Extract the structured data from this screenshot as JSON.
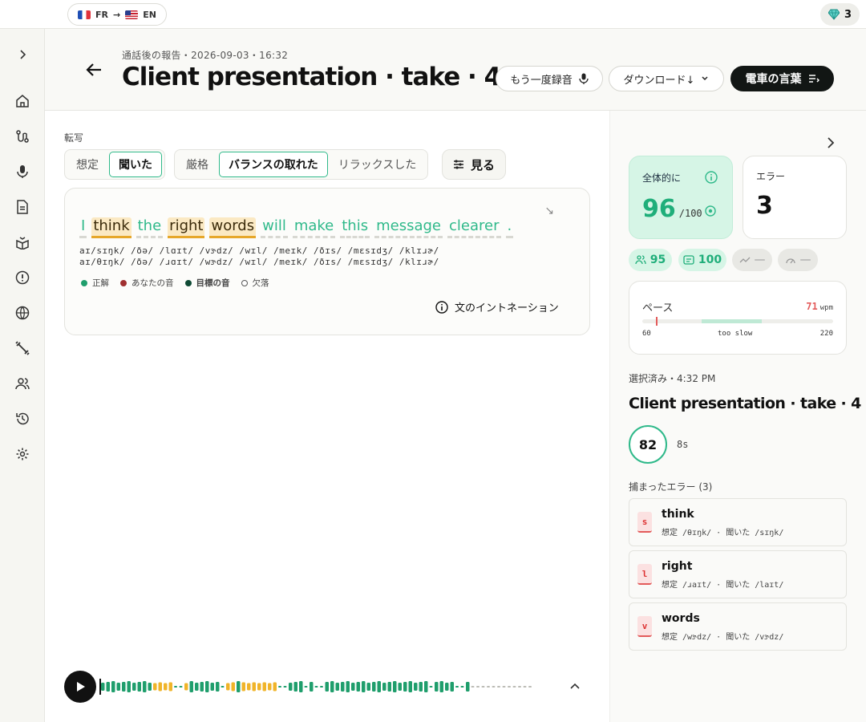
{
  "topbar": {
    "from": "FR",
    "to": "EN",
    "gems": "3"
  },
  "header": {
    "subtitle": "通話後の報告・2026-09-03・16:32",
    "title": "Client presentation · take · 4",
    "rerecord": "もう一度録音",
    "download": "ダウンロード↓",
    "phrases": "電車の言葉"
  },
  "transcript": {
    "label": "転写",
    "seg1": [
      "想定",
      "聞いた"
    ],
    "seg2": [
      "厳格",
      "バランスの取れた",
      "リラックスした"
    ],
    "view": "見る",
    "words": [
      "I",
      "think",
      "the",
      "right",
      "words",
      "will",
      "make",
      "this",
      "message",
      "clearer",
      "."
    ],
    "ipa_expected": "aɪ/sɪŋk/ /ðə/ /lɑɪt/ /vɝdz/ /wɪl/ /meɪk/ /ðɪs/ /mɛsɪdʒ/ /klɪɹɚ/",
    "ipa_heard": "aɪ/θɪŋk/ /ðə/ /ɹɑɪt/ /wɝdz/ /wɪl/ /meɪk/ /ðɪs/ /mɛsɪdʒ/ /klɪɹɚ/",
    "legend": [
      "正解",
      "あなたの音",
      "目標の音",
      "欠落"
    ],
    "intonation": "文のイントネーション"
  },
  "score": {
    "overall_label": "全体的に",
    "overall": "96",
    "overall_max": "/100",
    "errors_label": "エラー",
    "errors": "3",
    "chips": [
      "95",
      "100",
      "—",
      "—"
    ]
  },
  "pace": {
    "label": "ペース",
    "value": "71",
    "unit": "wpm",
    "min": "60",
    "note": "too slow",
    "max": "220",
    "level": 0.07
  },
  "selection": {
    "label": "選択済み・4:32 PM",
    "title": "Client presentation · take · 4",
    "score": "82",
    "duration": "8s",
    "errors_title": "捕まったエラー (3)",
    "errors": [
      {
        "badge": "s",
        "word": "think",
        "detail": "想定 /θɪŋk/ · 聞いた /sɪŋk/"
      },
      {
        "badge": "l",
        "word": "right",
        "detail": "想定 /ɹaɪt/ · 聞いた /laɪt/"
      },
      {
        "badge": "v",
        "word": "words",
        "detail": "想定 /wɝdz/ · 聞いた /vɝdz/"
      }
    ]
  },
  "colors": {
    "accent": "#2fb98a",
    "dark": "#121614",
    "error": "#e35b5b",
    "warn": "#e6a72a"
  }
}
